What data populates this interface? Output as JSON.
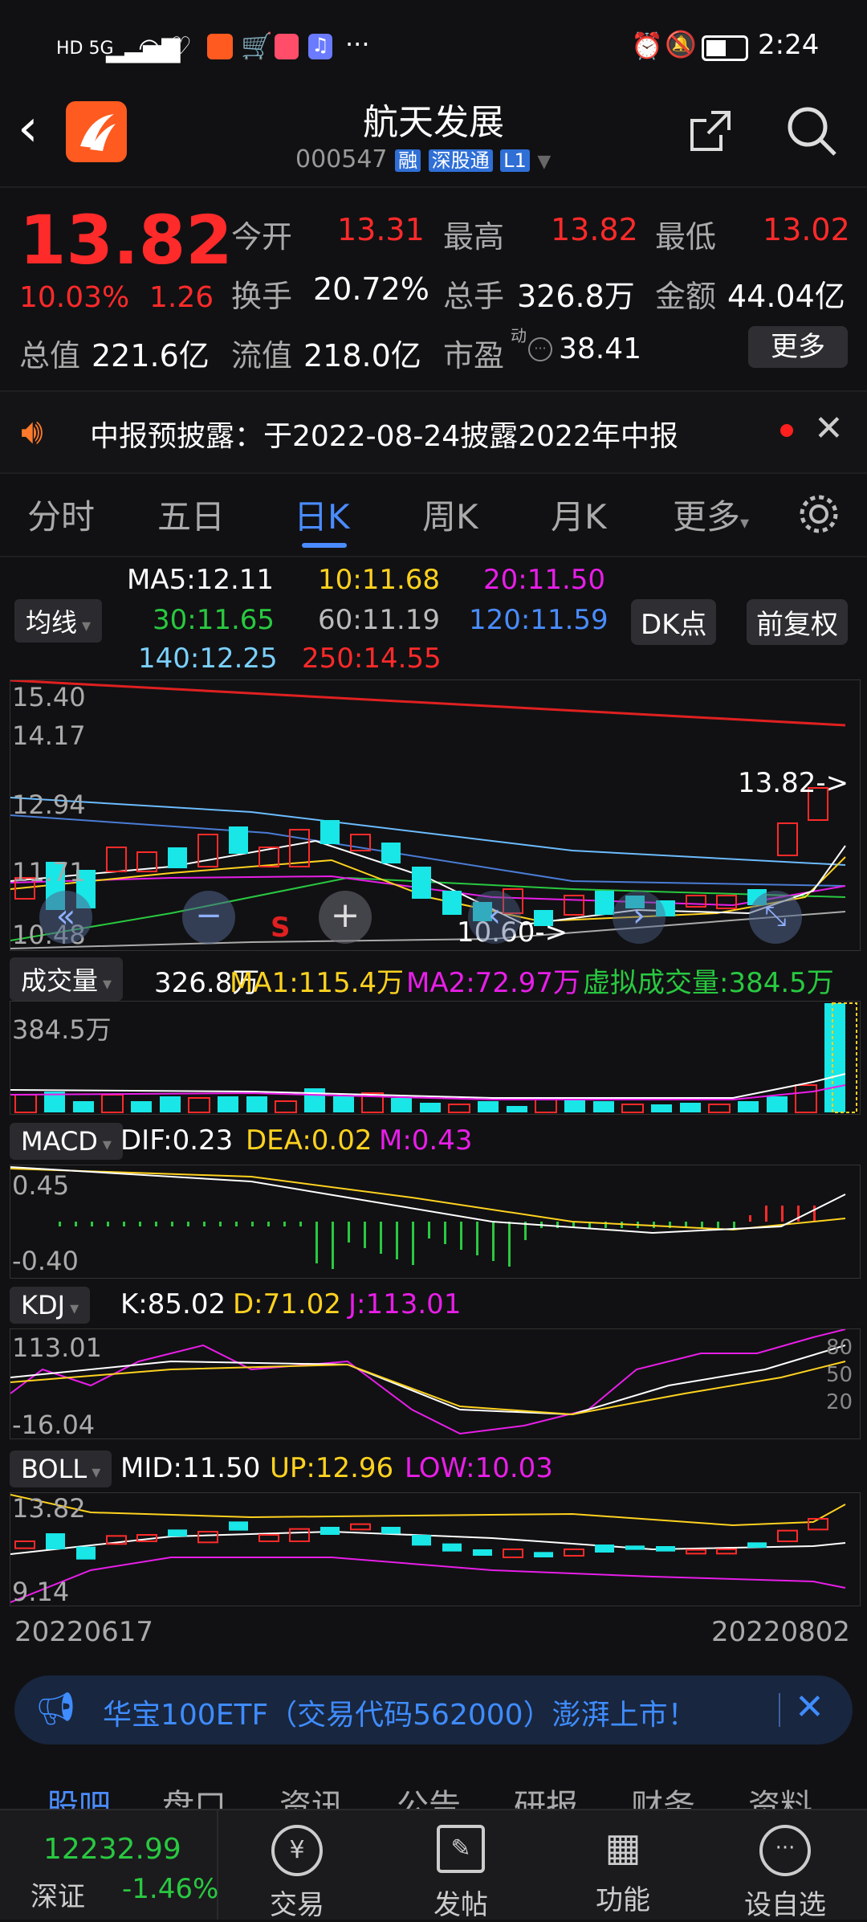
{
  "status_bar": {
    "time": "2:24",
    "network": "HD 5G",
    "extra": "···"
  },
  "header": {
    "title": "航天发展",
    "code": "000547",
    "badges": [
      "融",
      "深股通",
      "L1"
    ]
  },
  "quote": {
    "price": "13.82",
    "change_pct": "10.03%",
    "change_abs": "1.26",
    "open_label": "今开",
    "open": "13.31",
    "high_label": "最高",
    "high": "13.82",
    "low_label": "最低",
    "low": "13.02",
    "turnover_label": "换手",
    "turnover": "20.72%",
    "volume_label": "总手",
    "volume": "326.8万",
    "amount_label": "金额",
    "amount": "44.04亿",
    "mktcap_label": "总值",
    "mktcap": "221.6亿",
    "float_label": "流值",
    "float": "218.0亿",
    "pe_label": "市盈",
    "pe_sup": "动",
    "pe": "38.41",
    "more": "更多"
  },
  "notice": {
    "text": "中报预披露：于2022-08-24披露2022年中报"
  },
  "tabs": [
    "分时",
    "五日",
    "日K",
    "周K",
    "月K",
    "更多"
  ],
  "active_tab": 2,
  "ma": {
    "btn": "均线",
    "ma5": "MA5:12.11",
    "ma10": "10:11.68",
    "ma20": "20:11.50",
    "ma30": "30:11.65",
    "ma60": "60:11.19",
    "ma120": "120:11.59",
    "ma140": "140:12.25",
    "ma250": "250:14.55",
    "dk": "DK点",
    "adj": "前复权"
  },
  "kchart": {
    "axis": [
      "15.40",
      "14.17",
      "12.94",
      "11.71",
      "10.48"
    ],
    "last_label": "13.82->",
    "low_label": "10.60->",
    "s_mark": "S"
  },
  "volume": {
    "btn": "成交量",
    "vol": "326.8万",
    "ma1": "MA1:115.4万",
    "ma2": "MA2:72.97万",
    "virtual": "虚拟成交量:384.5万",
    "axis_top": "384.5万"
  },
  "macd": {
    "btn": "MACD",
    "dif": "DIF:0.23",
    "dea": "DEA:0.02",
    "m": "M:0.43",
    "axis_top": "0.45",
    "axis_bottom": "-0.40"
  },
  "kdj": {
    "btn": "KDJ",
    "k": "K:85.02",
    "d": "D:71.02",
    "j": "J:113.01",
    "axis_top": "113.01",
    "axis_bottom": "-16.04",
    "levels": [
      "80",
      "50",
      "20"
    ]
  },
  "boll": {
    "btn": "BOLL",
    "mid": "MID:11.50",
    "up": "UP:12.96",
    "low": "LOW:10.03",
    "axis_top": "13.82",
    "axis_bottom": "9.14"
  },
  "dates": {
    "start": "20220617",
    "end": "20220802"
  },
  "banner": {
    "text": "华宝100ETF（交易代码562000）澎湃上市！"
  },
  "sub_tabs": [
    "股吧",
    "盘口",
    "资讯",
    "公告",
    "研报",
    "财务",
    "资料"
  ],
  "index": {
    "value": "12232.99",
    "name": "深证",
    "change": "-1.46%"
  },
  "bottom_nav": [
    "交易",
    "发帖",
    "功能",
    "设自选"
  ],
  "colors": {
    "up": "#ff2a2a",
    "down": "#29c940",
    "cyan": "#19e6e6",
    "yellow": "#ffd21f",
    "magenta": "#e81ee8"
  }
}
